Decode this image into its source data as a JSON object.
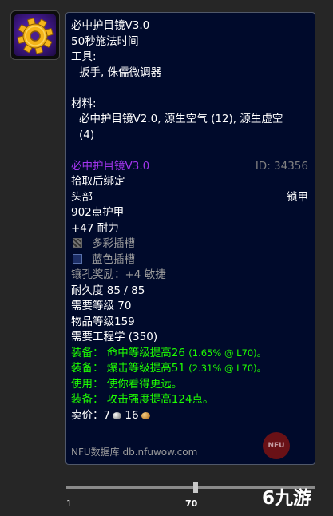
{
  "icon": {
    "name": "gear-icon",
    "accent": "#f4b41a"
  },
  "tooltip": {
    "item_name": "必中护目镜V3.0",
    "cast_time": "50秒施法时间",
    "tools_label": "工具:",
    "tools_value": "扳手, 侏儒微调器",
    "materials_label": "材料:",
    "materials_line1": "必中护目镜V2.0, 源生空气 (12), 源生虚空",
    "materials_line2": "(4)",
    "result_name": "必中护目镜V3.0",
    "result_id": "ID: 34356",
    "binding": "拾取后绑定",
    "slot": "头部",
    "armor_type": "锁甲",
    "armor": "902点护甲",
    "stamina": "+47 耐力",
    "socket_prismatic": "多彩插槽",
    "socket_blue": "蓝色插槽",
    "socket_bonus": "镶孔奖励：+4 敏捷",
    "durability": "耐久度 85 / 85",
    "req_level": "需要等级 70",
    "item_level": "物品等级159",
    "req_skill": "需要工程学 (350)",
    "effect1_main": "装备： 命中等级提高26",
    "effect1_note": "(1.65% @ L70)。",
    "effect2_main": "装备： 爆击等级提高51",
    "effect2_note": "(2.31% @ L70)。",
    "effect3": "使用： 使你看得更远。",
    "effect4": "装备： 攻击强度提高124点。",
    "sell_label": "卖价：7",
    "sell_copper": "16",
    "source": "NFU数据库 db.nfuwow.com",
    "logo_text": "NFU"
  },
  "slider": {
    "min_label": "1",
    "current_label": "70",
    "min": 1,
    "max": 70,
    "value": 70
  },
  "watermark": "6九游",
  "colors": {
    "background": "#262626",
    "tooltip_bg": "#000a2b",
    "epic": "#a335ee",
    "green": "#1eff00",
    "grey": "#9d9d9d"
  }
}
